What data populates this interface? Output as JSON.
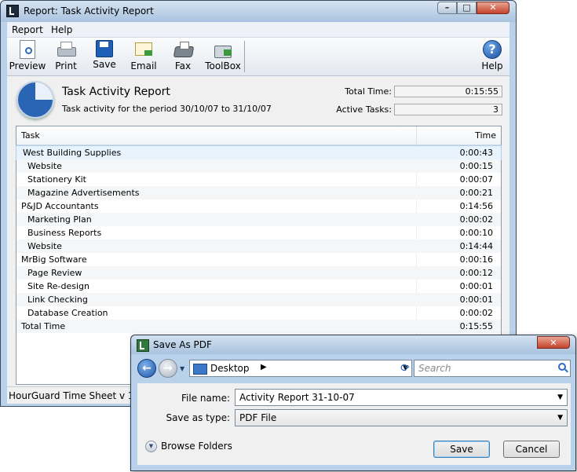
{
  "window": {
    "title": "Report: Task Activity Report",
    "caption_buttons": {
      "minimize": "–",
      "maximize": "□",
      "close": "✕"
    }
  },
  "menu": [
    "Report",
    "Help"
  ],
  "toolbar": {
    "preview": "Preview",
    "print": "Print",
    "save": "Save",
    "email": "Email",
    "fax": "Fax",
    "toolbox": "ToolBox",
    "help": "Help"
  },
  "report": {
    "title": "Task Activity Report",
    "subtitle": "Task activity for the period 30/10/07 to 31/10/07",
    "total_time_label": "Total Time:",
    "total_time_value": "0:15:55",
    "active_tasks_label": "Active Tasks:",
    "active_tasks_value": "3"
  },
  "table": {
    "headers": {
      "task": "Task",
      "time": "Time"
    },
    "rows": [
      {
        "task": "West Building Supplies",
        "time": "0:00:43",
        "level": 0
      },
      {
        "task": "Website",
        "time": "0:00:15",
        "level": 1
      },
      {
        "task": "Stationery Kit",
        "time": "0:00:07",
        "level": 1
      },
      {
        "task": "Magazine Advertisements",
        "time": "0:00:21",
        "level": 1
      },
      {
        "task": "P&JD Accountants",
        "time": "0:14:56",
        "level": 0
      },
      {
        "task": "Marketing Plan",
        "time": "0:00:02",
        "level": 1
      },
      {
        "task": "Business Reports",
        "time": "0:00:10",
        "level": 1
      },
      {
        "task": "Website",
        "time": "0:14:44",
        "level": 1
      },
      {
        "task": "MrBig Software",
        "time": "0:00:16",
        "level": 0
      },
      {
        "task": "Page Review",
        "time": "0:00:12",
        "level": 1
      },
      {
        "task": "Site Re-design",
        "time": "0:00:01",
        "level": 1
      },
      {
        "task": "Link Checking",
        "time": "0:00:01",
        "level": 1
      },
      {
        "task": "Database Creation",
        "time": "0:00:02",
        "level": 1
      },
      {
        "task": "Total Time",
        "time": "0:15:55",
        "level": 0
      }
    ]
  },
  "status": "HourGuard Time Sheet v 1.00",
  "dialog": {
    "title": "Save As PDF",
    "close": "✕",
    "location": "Desktop",
    "search_placeholder": "Search",
    "file_name_label": "File name:",
    "file_name_value": "Activity Report 31-10-07",
    "save_type_label": "Save as type:",
    "save_type_value": "PDF File",
    "browse_folders": "Browse Folders",
    "save_button": "Save",
    "cancel_button": "Cancel"
  }
}
